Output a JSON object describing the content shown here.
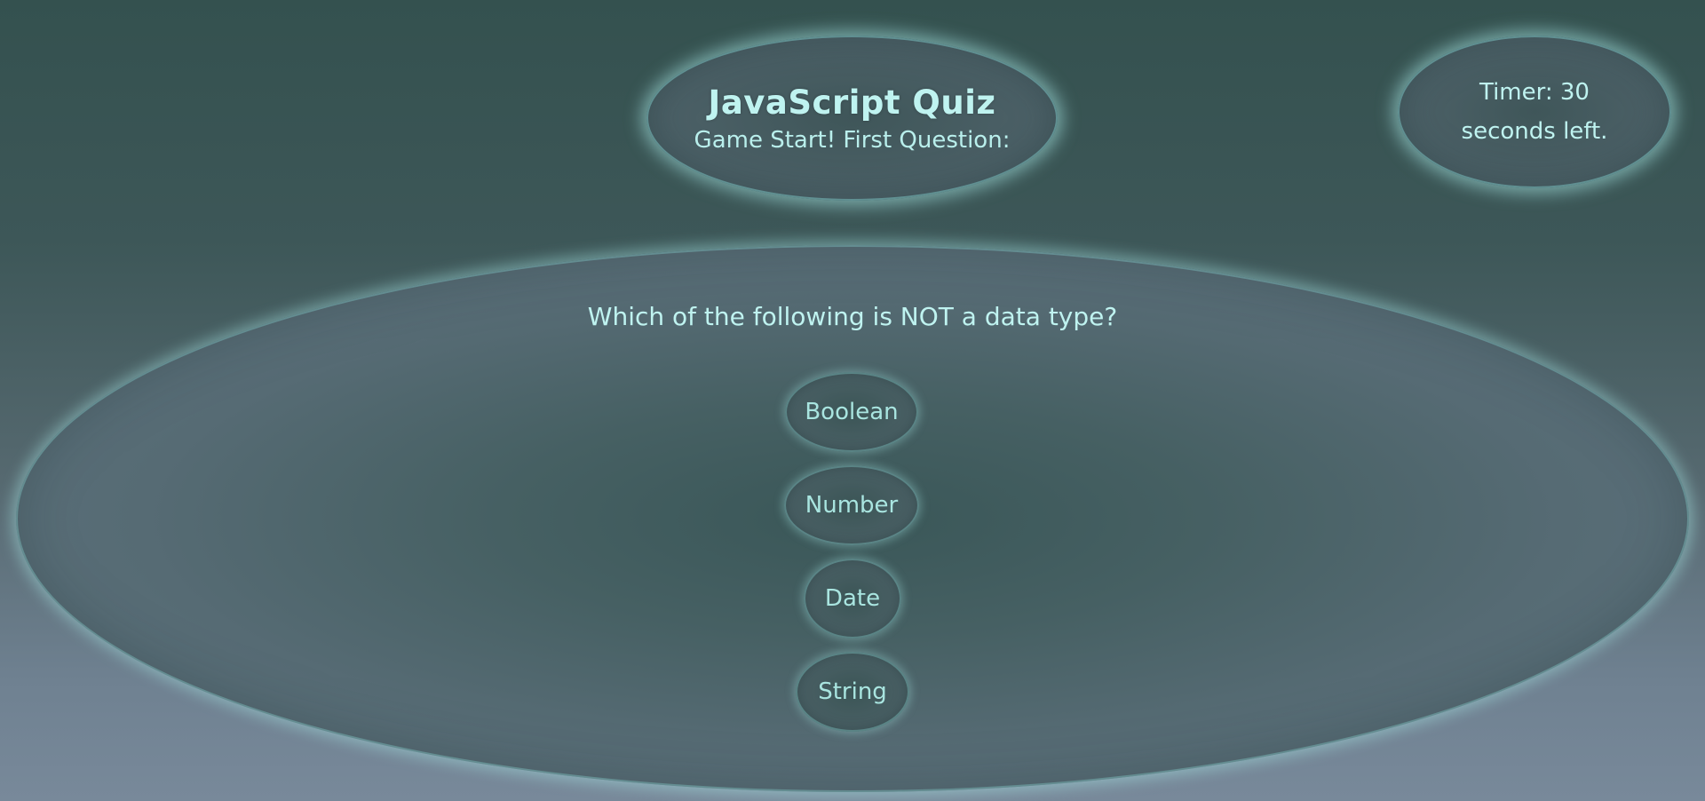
{
  "header": {
    "title": "JavaScript Quiz",
    "subtitle": "Game Start! First Question:"
  },
  "timer": {
    "text": "Timer: 30 seconds left."
  },
  "quiz": {
    "question": "Which of the following is NOT a data type?",
    "answers": [
      {
        "label": "Boolean"
      },
      {
        "label": "Number"
      },
      {
        "label": "Date"
      },
      {
        "label": "String"
      }
    ]
  },
  "colors": {
    "text": "#bff3f0",
    "glow": "#aaebe8",
    "background_top": "#34514f",
    "background_bottom": "#78899a"
  }
}
